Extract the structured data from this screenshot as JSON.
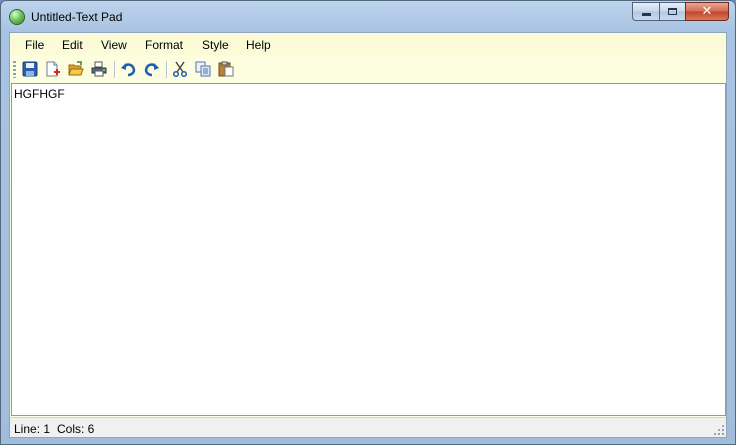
{
  "window": {
    "title": "Untitled-Text Pad",
    "close_glyph": "✕"
  },
  "menu": {
    "items": [
      {
        "label": "File"
      },
      {
        "label": "Edit"
      },
      {
        "label": "View"
      },
      {
        "label": "Format"
      },
      {
        "label": "Style"
      },
      {
        "label": "Help"
      }
    ]
  },
  "toolbar": {
    "buttons": [
      {
        "icon": "save-icon"
      },
      {
        "icon": "new-file-icon"
      },
      {
        "icon": "open-folder-icon"
      },
      {
        "icon": "print-icon"
      },
      {
        "icon": "undo-icon"
      },
      {
        "icon": "redo-icon"
      },
      {
        "icon": "cut-icon"
      },
      {
        "icon": "copy-icon"
      },
      {
        "icon": "paste-icon"
      }
    ]
  },
  "editor": {
    "content": "HGFHGF"
  },
  "status": {
    "line": "Line: 1",
    "cols": "Cols: 6"
  },
  "colors": {
    "menubar_bg": "#fbfbd8",
    "statusbar_bg": "#f0f0f0",
    "close_button": "#c7472e"
  }
}
